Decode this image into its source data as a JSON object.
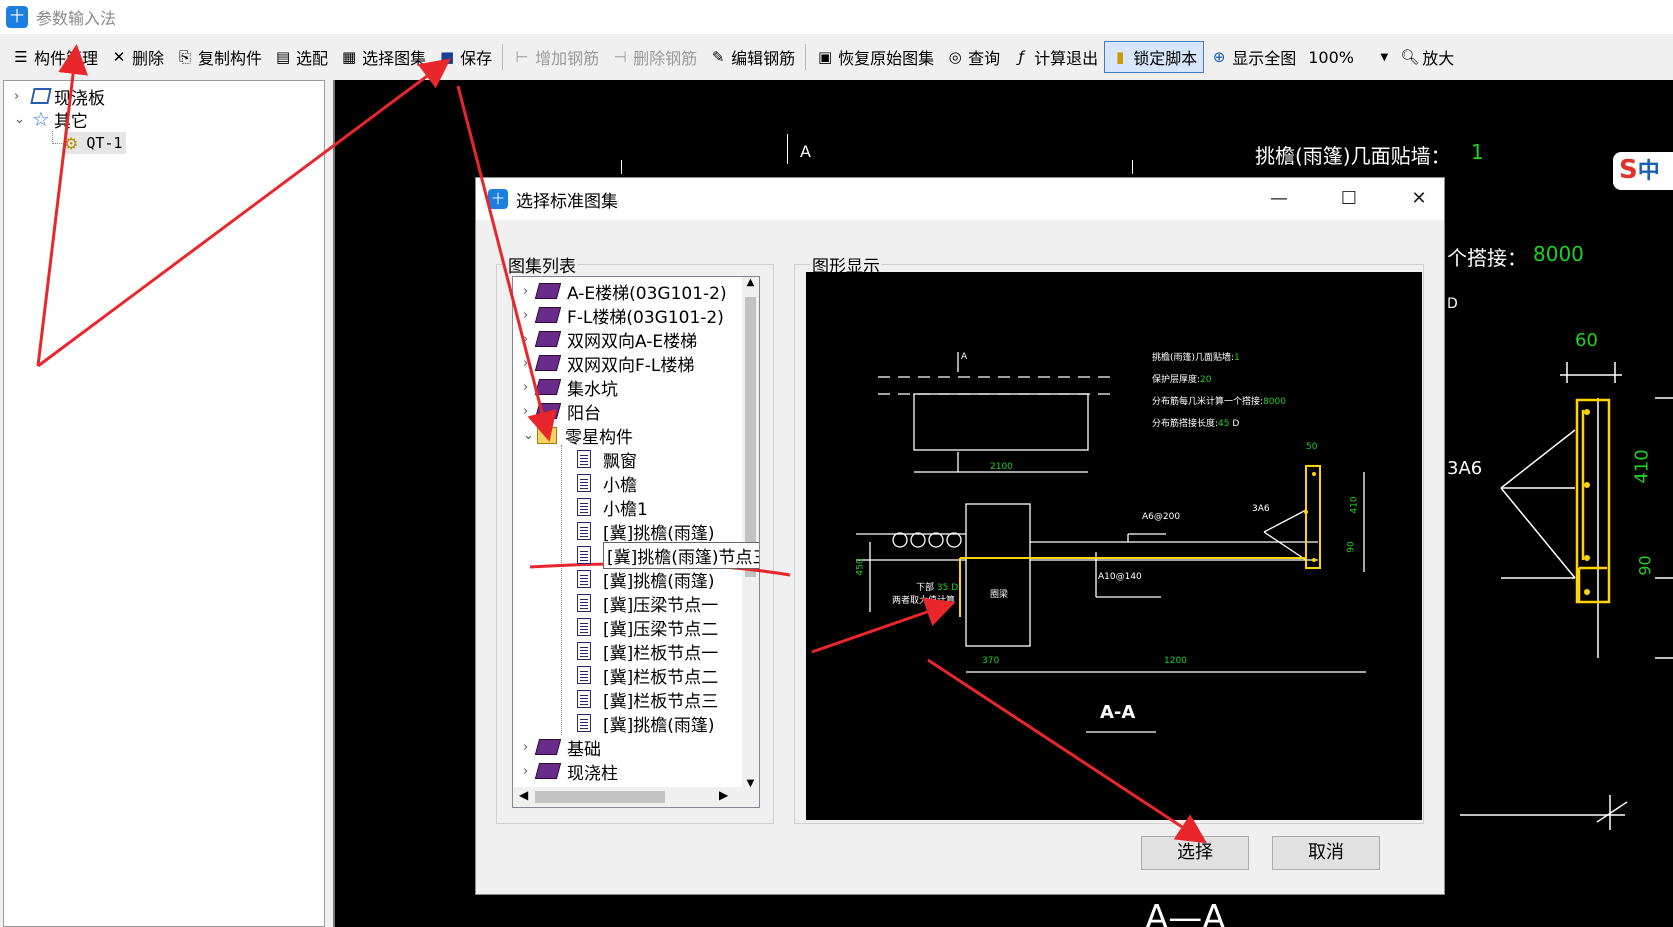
{
  "window": {
    "title": "参数输入法"
  },
  "toolbar": {
    "items": [
      {
        "label": "构件管理",
        "icon": "list-icon"
      },
      {
        "label": "删除",
        "icon": "delete-icon"
      },
      {
        "label": "复制构件",
        "icon": "copy-icon"
      },
      {
        "label": "选配",
        "icon": "paste-icon"
      },
      {
        "label": "选择图集",
        "icon": "atlas-icon"
      },
      {
        "label": "保存",
        "icon": "save-icon"
      },
      {
        "label": "增加钢筋",
        "icon": "add-rebar-icon",
        "disabled": true
      },
      {
        "label": "删除钢筋",
        "icon": "remove-rebar-icon",
        "disabled": true
      },
      {
        "label": "编辑钢筋",
        "icon": "edit-rebar-icon"
      },
      {
        "label": "恢复原始图集",
        "icon": "restore-icon"
      },
      {
        "label": "查询",
        "icon": "binoculars-icon"
      },
      {
        "label": "计算退出",
        "icon": "function-icon"
      },
      {
        "label": "锁定脚本",
        "icon": "lock-icon",
        "active": true
      },
      {
        "label": "显示全图",
        "icon": "fit-icon"
      },
      {
        "label": "放大",
        "icon": "zoom-in-icon"
      }
    ],
    "zoom": "100%"
  },
  "left_tree": [
    {
      "label": "现浇板"
    },
    {
      "label": "其它"
    },
    {
      "label": "QT-1"
    }
  ],
  "canvas": {
    "label_a": "A",
    "param1_label": "挑檐(雨篷)几面贴墙：",
    "param1_value": "1",
    "param2_label": "个搭接：",
    "param2_value": "8000",
    "d": "D",
    "dim60": "60",
    "dim410": "410",
    "dim90": "90",
    "rebar": "3A6",
    "section": "A—A"
  },
  "dialog": {
    "title": "选择标准图集",
    "list_group": "图集列表",
    "preview_group": "图形显示",
    "items": [
      {
        "label": "A-E楼梯(03G101-2)",
        "type": "book"
      },
      {
        "label": "F-L楼梯(03G101-2)",
        "type": "book"
      },
      {
        "label": "双网双向A-E楼梯",
        "type": "book"
      },
      {
        "label": "双网双向F-L楼梯",
        "type": "book"
      },
      {
        "label": "集水坑",
        "type": "book"
      },
      {
        "label": "阳台",
        "type": "book"
      },
      {
        "label": "零星构件",
        "type": "folder"
      },
      {
        "label": "飘窗",
        "type": "doc"
      },
      {
        "label": "小檐",
        "type": "doc"
      },
      {
        "label": "小檐1",
        "type": "doc"
      },
      {
        "label": "[冀]挑檐(雨篷)",
        "type": "doc"
      },
      {
        "label": "[冀]挑檐(雨篷)节点三",
        "type": "doc",
        "selected": true
      },
      {
        "label": "[冀]挑檐(雨篷)",
        "type": "doc"
      },
      {
        "label": "[冀]压梁节点一",
        "type": "doc"
      },
      {
        "label": "[冀]压梁节点二",
        "type": "doc"
      },
      {
        "label": "[冀]栏板节点一",
        "type": "doc"
      },
      {
        "label": "[冀]栏板节点二",
        "type": "doc"
      },
      {
        "label": "[冀]栏板节点三",
        "type": "doc"
      },
      {
        "label": "[冀]挑檐(雨篷)",
        "type": "doc"
      },
      {
        "label": "基础",
        "type": "book"
      },
      {
        "label": "现浇柱",
        "type": "book"
      }
    ],
    "preview": {
      "p1": "挑檐(雨篷)几面贴墙:",
      "p1v": "1",
      "p2": "保护层厚度:",
      "p2v": "20",
      "p3": "分布筋每几米计算一个搭接:",
      "p3v": "8000",
      "p4": "分布筋搭接长度:",
      "p4v": "45",
      "p4u": "D",
      "a": "A",
      "d2100": "2100",
      "d50": "50",
      "d410": "410",
      "d90": "90",
      "d450": "450",
      "d370": "370",
      "d1200": "1200",
      "r3a6": "3A6",
      "a6200": "A6@200",
      "a10140": "A10@140",
      "beam": "圈梁",
      "note1": "下部",
      "note1v": "35 D",
      "note2": "两者取大值计算",
      "section": "A-A"
    },
    "ok": "选择",
    "cancel": "取消"
  }
}
